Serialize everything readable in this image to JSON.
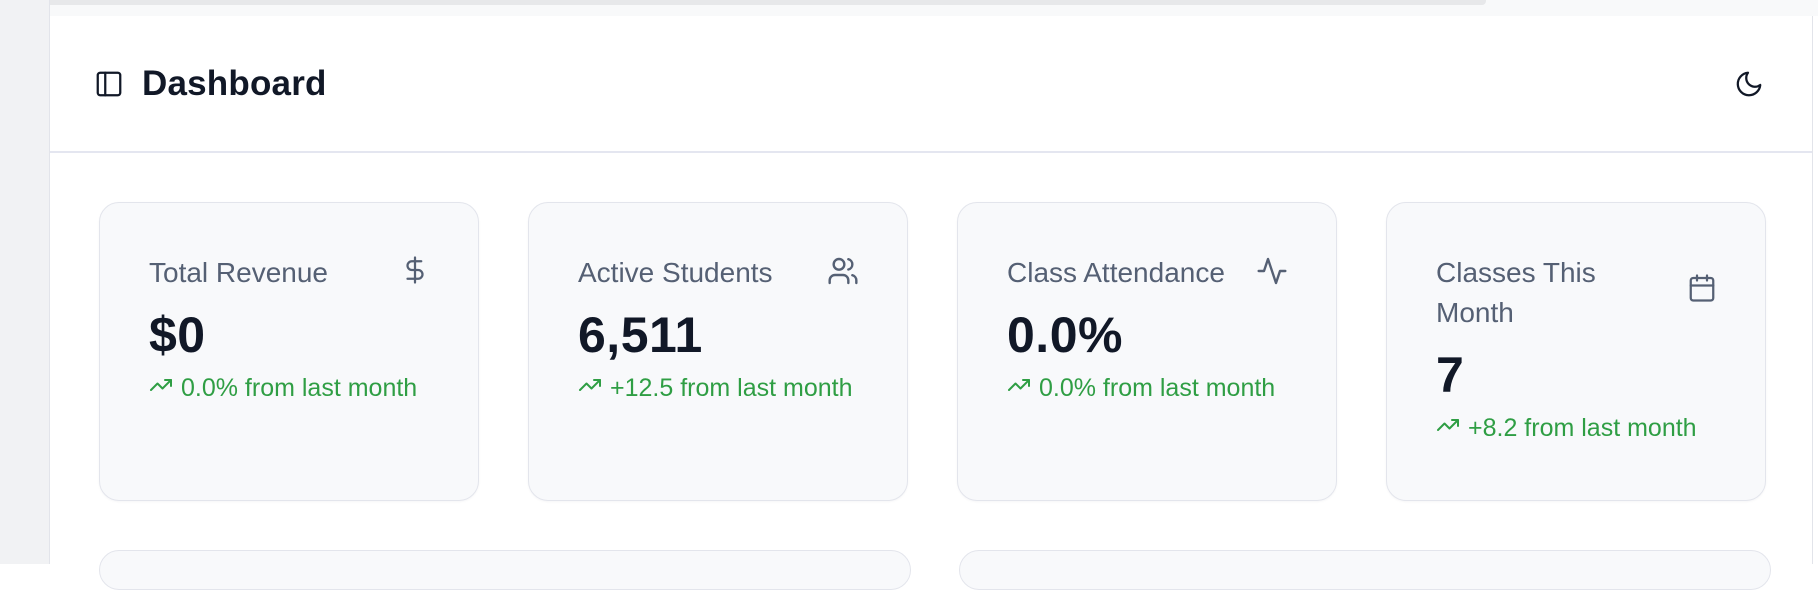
{
  "header": {
    "title": "Dashboard",
    "sidebar_toggle_icon": "sidebar-toggle-icon",
    "theme_toggle_icon": "moon-icon"
  },
  "cards": [
    {
      "title": "Total Revenue",
      "value": "$0",
      "change": "0.0% from last month",
      "icon": "dollar-icon"
    },
    {
      "title": "Active Students",
      "value": "6,511",
      "change": "+12.5 from last month",
      "icon": "users-icon"
    },
    {
      "title": "Class Attendance",
      "value": "0.0%",
      "change": "0.0% from last month",
      "icon": "activity-icon"
    },
    {
      "title": "Classes This Month",
      "value": "7",
      "change": "+8.2 from last month",
      "icon": "calendar-icon"
    }
  ],
  "colors": {
    "accent_green": "#2f9e44",
    "title_text": "#111827",
    "muted_text": "#556074",
    "card_bg": "#f8f9fb"
  }
}
